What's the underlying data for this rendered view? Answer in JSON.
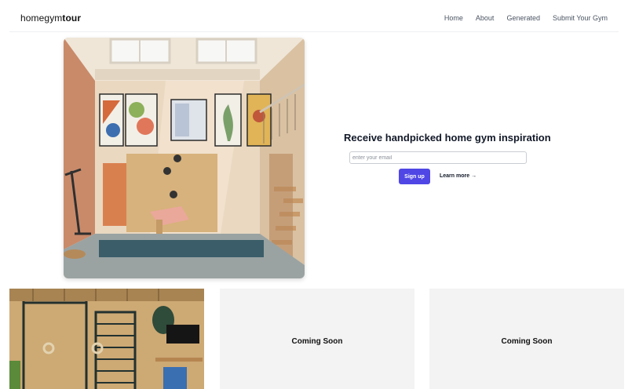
{
  "header": {
    "logo_light": "homegym",
    "logo_bold": "tour",
    "nav": [
      "Home",
      "About",
      "Generated",
      "Submit Your Gym"
    ]
  },
  "subscribe": {
    "title": "Receive handpicked home gym inspiration",
    "email_placeholder": "enter your email",
    "signup_label": "Sign up",
    "learn_more_label": "Learn more →"
  },
  "cards": {
    "coming_soon_1": "Coming Soon",
    "coming_soon_2": "Coming Soon"
  },
  "colors": {
    "accent": "#4f46e5",
    "card_bg": "#f3f3f3"
  }
}
